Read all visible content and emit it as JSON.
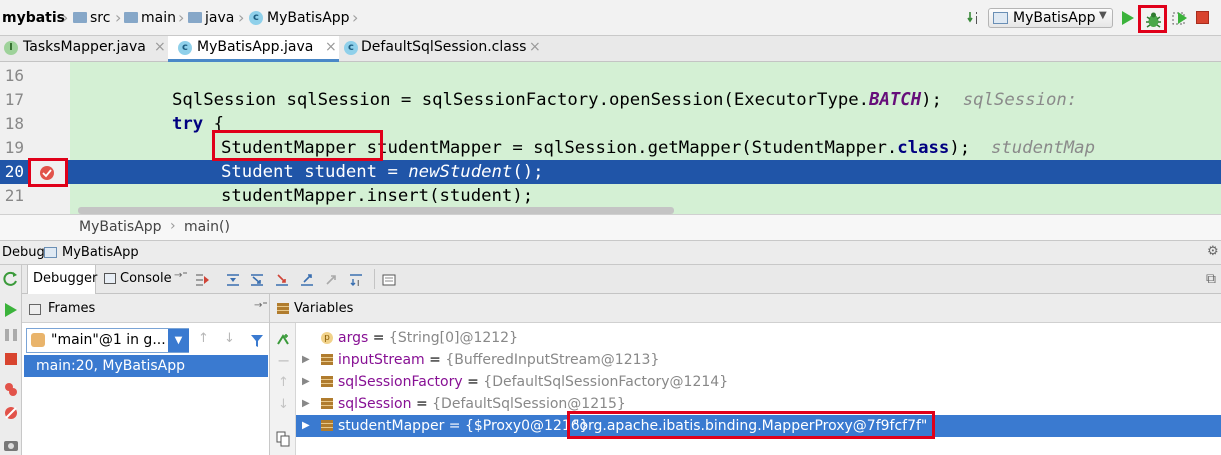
{
  "nav": {
    "crumbs": [
      "mybatis",
      "src",
      "main",
      "java",
      "MyBatisApp"
    ],
    "run_config": "MyBatisApp"
  },
  "tabs": [
    {
      "label": "TasksMapper.java",
      "icon": "interface-icon"
    },
    {
      "label": "MyBatisApp.java",
      "icon": "class-icon",
      "active": true
    },
    {
      "label": "DefaultSqlSession.class",
      "icon": "class-icon"
    }
  ],
  "editor": {
    "line_numbers": [
      "16",
      "17",
      "18",
      "19",
      "20",
      "21"
    ],
    "lines": {
      "l17": {
        "a": "SqlSession sqlSession = sqlSessionFactory.openSession(ExecutorType.",
        "b": "BATCH",
        "c": ");",
        "hint": "sqlSession: "
      },
      "l18": {
        "kw": "try",
        "rest": " {"
      },
      "l19": {
        "boxed": "StudentMapper",
        "rest": " studentMapper = sqlSession.getMapper(StudentMapper.",
        "kw": "class",
        "end": ");",
        "hint": "studentMap"
      },
      "l20": {
        "a": "Student student = ",
        "b": "newStudent",
        "c": "();"
      },
      "l21": {
        "a": "studentMapper.insert(student);"
      }
    },
    "breadcrumb": [
      "MyBatisApp",
      "main()"
    ]
  },
  "debug": {
    "title": "Debug",
    "config": "MyBatisApp",
    "tabs": [
      "Debugger",
      "Console"
    ],
    "frames_title": "Frames",
    "thread_selector": "\"main\"@1 in g...",
    "frames": [
      "main:20, MyBatisApp"
    ],
    "variables_title": "Variables",
    "variables": [
      {
        "name": "args",
        "value": "{String[0]@1212}",
        "kind": "param"
      },
      {
        "name": "inputStream",
        "value": "{BufferedInputStream@1213}",
        "kind": "object"
      },
      {
        "name": "sqlSessionFactory",
        "value": "{DefaultSqlSessionFactory@1214}",
        "kind": "object"
      },
      {
        "name": "sqlSession",
        "value": "{DefaultSqlSession@1215}",
        "kind": "object"
      },
      {
        "name": "studentMapper",
        "value": "{$Proxy0@1216}",
        "extra": "\"org.apache.ibatis.binding.MapperProxy@7f9fcf7f\"",
        "kind": "object",
        "selected": true
      }
    ]
  },
  "colors": {
    "editor_bg": "#d4f0d4",
    "selection": "#2055a8",
    "highlight_box": "#e0001a",
    "keyword": "#000080"
  }
}
